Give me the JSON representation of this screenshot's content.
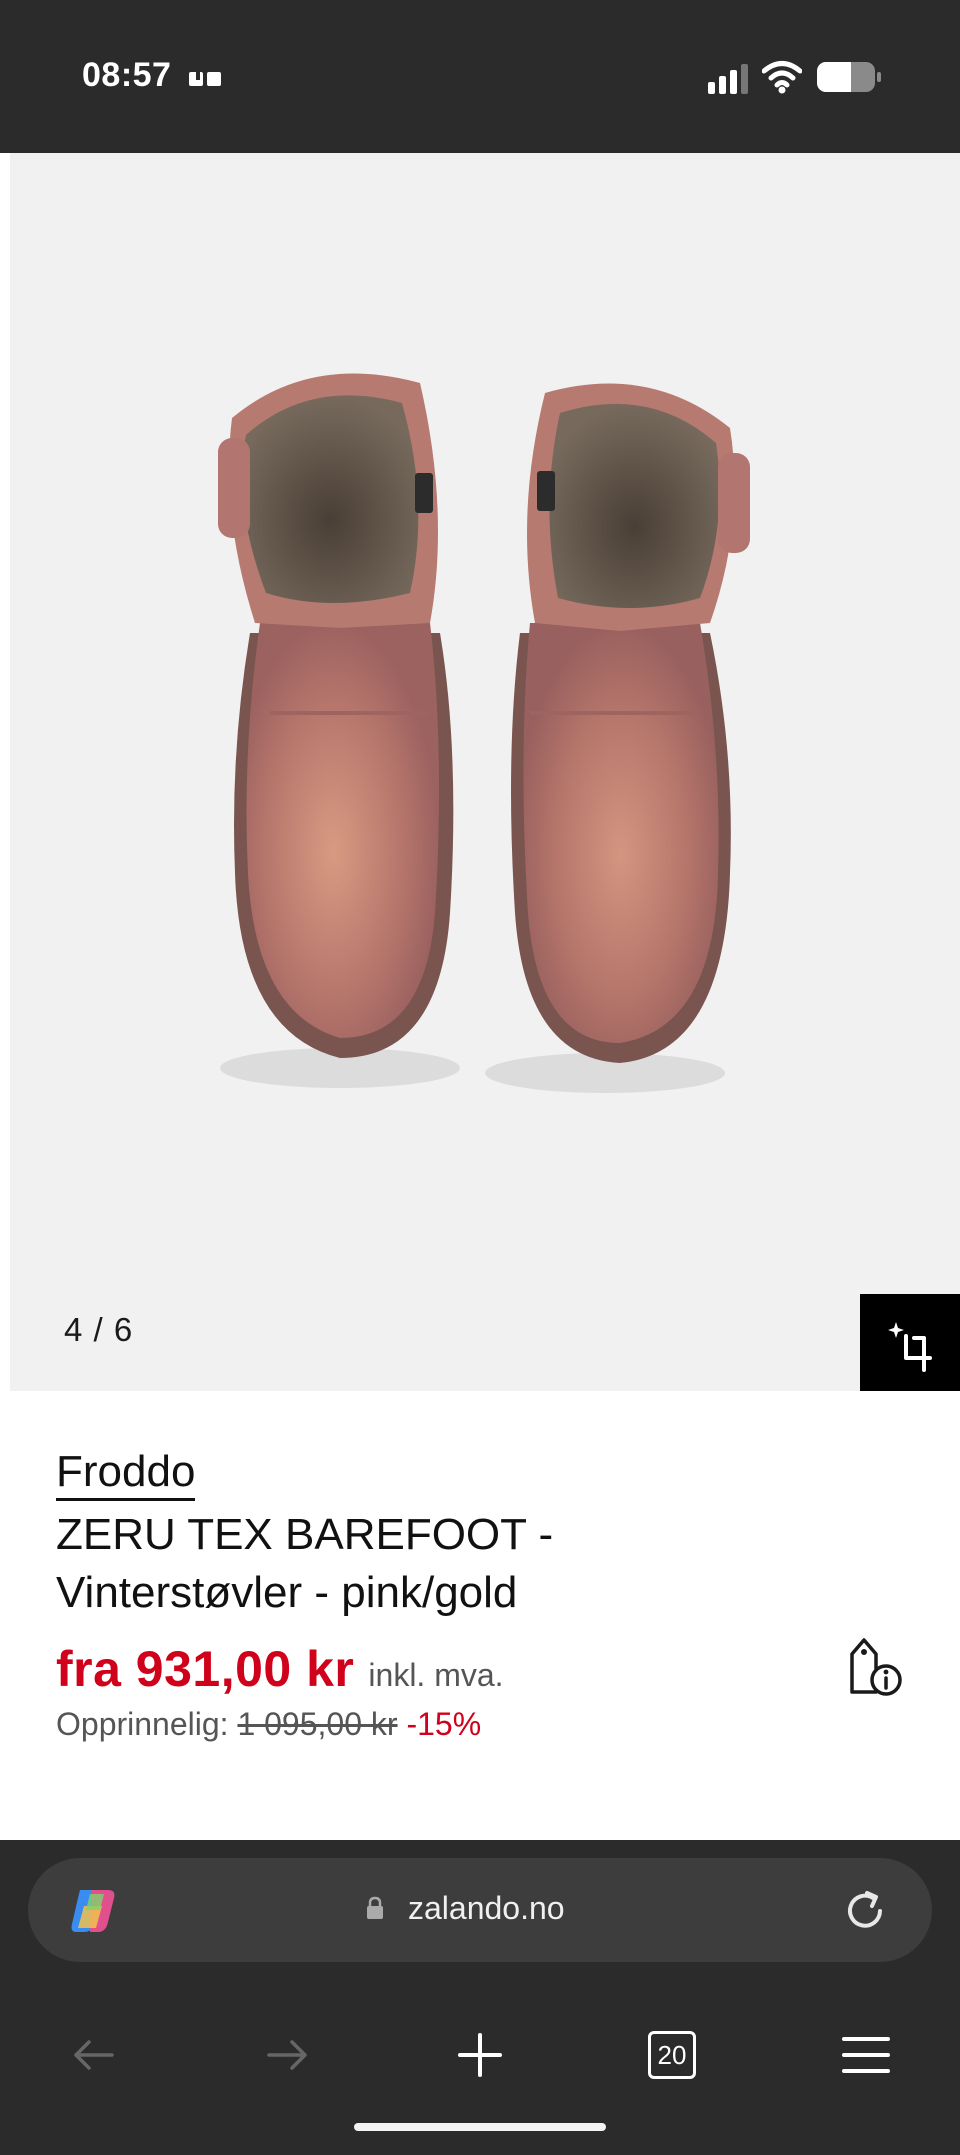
{
  "status_bar": {
    "time": "08:57"
  },
  "gallery": {
    "counter": "4 / 6"
  },
  "product": {
    "brand": "Froddo",
    "title_line1": "ZERU TEX BAREFOOT -",
    "title_line2": "Vinterstøvler - pink/gold",
    "price": "fra 931,00 kr",
    "vat_note": "inkl. mva.",
    "original_label": "Opprinnelig:",
    "original_price": "1 095,00 kr",
    "discount": "-15%"
  },
  "browser": {
    "url": "zalando.no",
    "tab_count": "20"
  },
  "colors": {
    "price_red": "#d0021b",
    "chrome_dark": "#2b2b2b",
    "gallery_bg": "#f1f1f1"
  }
}
